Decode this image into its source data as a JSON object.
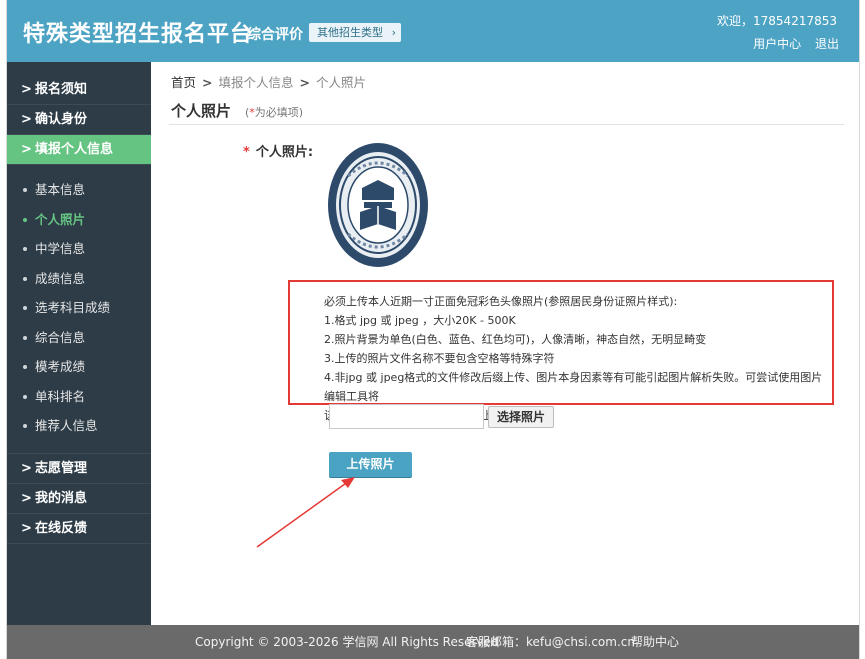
{
  "header": {
    "brand": "特殊类型招生报名平台",
    "subbrand": "综合评价",
    "other_type_button": "其他招生类型",
    "welcome": "欢迎，17854217853",
    "user_center": "用户中心",
    "logout": "退出"
  },
  "sidebar": {
    "top_items": [
      {
        "label": "报名须知"
      },
      {
        "label": "确认身份"
      },
      {
        "label": "填报个人信息"
      }
    ],
    "sub_items": [
      {
        "label": "基本信息"
      },
      {
        "label": "个人照片"
      },
      {
        "label": "中学信息"
      },
      {
        "label": "成绩信息"
      },
      {
        "label": "选考科目成绩"
      },
      {
        "label": "综合信息"
      },
      {
        "label": "模考成绩"
      },
      {
        "label": "单科排名"
      },
      {
        "label": "推荐人信息"
      }
    ],
    "bottom_items": [
      {
        "label": "志愿管理"
      },
      {
        "label": "我的消息"
      },
      {
        "label": "在线反馈"
      }
    ],
    "arrow_glyph": ">"
  },
  "breadcrumb": {
    "home": "首页",
    "level2": "填报个人信息",
    "current": "个人照片",
    "sep": ">"
  },
  "page": {
    "title": "个人照片",
    "required_star": "*",
    "required_hint": "为必填项",
    "field_label": "个人照片:",
    "notice_lines": [
      "必须上传本人近期一寸正面免冠彩色头像照片(参照居民身份证照片样式):",
      "1.格式 jpg 或 jpeg ，大小20K - 500K",
      "2.照片背景为单色(白色、蓝色、红色均可)，人像清晰，神态自然，无明显畸变",
      "3.上传的照片文件名称不要包含空格等特殊字符",
      "4.非jpg 或 jpeg格式的文件修改后缀上传、图片本身因素等有可能引起图片解析失败。可尝试使用图片编辑工具将",
      "该图另存为jpg 或 jpeg格式然后上传"
    ],
    "file_input_value": "",
    "choose_button": "选择照片",
    "upload_button": "上传照片"
  },
  "footer": {
    "copyright": "Copyright © 2003-2026 学信网 All Rights Reserved",
    "email": "客服邮箱：kefu@chsi.com.cn",
    "help": "帮助中心"
  },
  "colors": {
    "header_bg": "#4da3c4",
    "sidebar_bg": "#2d3c47",
    "active_green": "#66c483",
    "notice_border": "#e53935",
    "upload_button": "#4aa3c2",
    "footer_bg": "#6a6a6a"
  }
}
